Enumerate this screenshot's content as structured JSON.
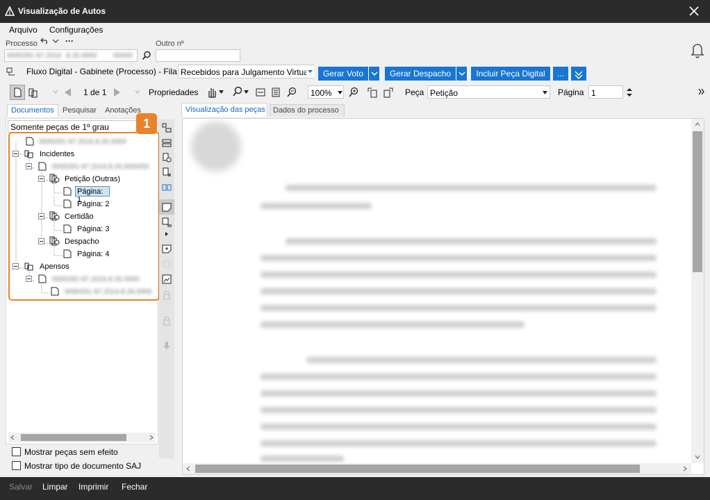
{
  "window": {
    "title": "Visualização de Autos"
  },
  "menu": {
    "arquivo": "Arquivo",
    "configuracoes": "Configurações"
  },
  "header": {
    "processo_label": "Processo",
    "outro_label": "Outro nº",
    "processo_value_1": "0000291-97.2016",
    "processo_value_2": "8.26.0000",
    "processo_value_3": "00000"
  },
  "flow": {
    "label": "Fluxo Digital - Gabinete (Processo) - Fila:",
    "queue_value": "Recebidos para Julgamento Virtua",
    "gerar_voto": "Gerar Voto",
    "gerar_despacho": "Gerar Despacho",
    "incluir_peca": "Incluir Peça Digital",
    "more": "..."
  },
  "toolbar": {
    "page_counter": "1 de 1",
    "propriedades": "Propriedades",
    "zoom": "100%",
    "peca_label": "Peça",
    "peca_value": "Petição",
    "pagina_label": "Página",
    "pagina_value": "1"
  },
  "left_tabs": {
    "documentos": "Documentos",
    "pesquisar": "Pesquisar",
    "anotacoes": "Anotações"
  },
  "filter_value": "Somente peças de 1º grau",
  "badge": "1",
  "tree": {
    "root": "0000291-97.2016.8.26.0000",
    "incidentes": "Incidentes",
    "incidente_1": "0000291-97.2016.8.26.0000/50",
    "peticao": "Petição (Outras)",
    "pagina1": "Página: 1",
    "pagina2": "Página: 2",
    "certidao": "Certidão",
    "pagina3": "Página: 3",
    "despacho": "Despacho",
    "pagina4": "Página: 4",
    "apensos": "Apensos",
    "apenso_1": "0000291-97.2016.8.26.0000",
    "apenso_2": "0000291-97.2016.8.26.0000"
  },
  "checkboxes": {
    "sem_efeito": "Mostrar peças sem efeito",
    "tipo_saj": "Mostrar tipo de documento SAJ"
  },
  "right_tabs": {
    "visualizacao": "Visualização das peças",
    "dados": "Dados do processo"
  },
  "bottom": {
    "salvar": "Salvar",
    "limpar": "Limpar",
    "imprimir": "Imprimir",
    "fechar": "Fechar"
  },
  "colors": {
    "accent": "#1976d2",
    "badge": "#e8832a",
    "titlebar": "#2b2b2b"
  }
}
